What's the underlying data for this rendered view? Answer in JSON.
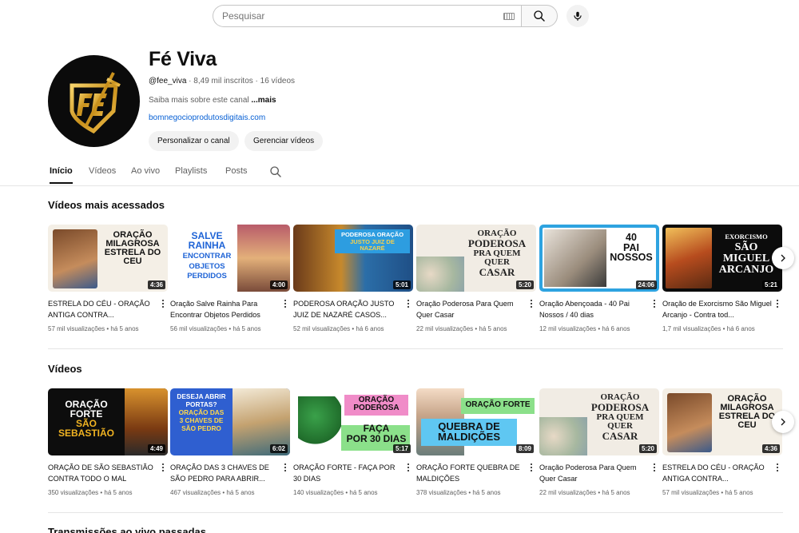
{
  "search": {
    "placeholder": "Pesquisar"
  },
  "channel": {
    "name": "Fé Viva",
    "handle": "@fee_viva",
    "subscribers": "8,49 mil inscritos",
    "videos_count": "16 vídeos",
    "separator": " · ",
    "description": "Saiba mais sobre este canal",
    "more": "...mais",
    "link": "bomnegocioprodutosdigitais.com",
    "customize_label": "Personalizar o canal",
    "manage_label": "Gerenciar vídeos"
  },
  "tabs": [
    {
      "label": "Início",
      "active": true
    },
    {
      "label": "Vídeos"
    },
    {
      "label": "Ao vivo"
    },
    {
      "label": "Playlists"
    },
    {
      "label": "Posts"
    }
  ],
  "sections": [
    {
      "title": "Vídeos mais acessados",
      "videos": [
        {
          "title": "ESTRELA DO CÉU - ORAÇÃO ANTIGA CONTRA...",
          "views": "57 mil visualizações",
          "age": "há 5 anos",
          "duration": "4:36",
          "thumb_text": [
            "ORAÇÃO",
            "MILAGROSA",
            "ESTRELA DO",
            "CEU"
          ]
        },
        {
          "title": "Oração Salve Rainha Para Encontrar Objetos Perdidos",
          "views": "56 mil visualizações",
          "age": "há 5 anos",
          "duration": "4:00",
          "thumb_text": [
            "SALVE",
            "RAINHA",
            "ENCONTRAR",
            "OBJETOS",
            "PERDIDOS"
          ]
        },
        {
          "title": "PODEROSA ORAÇÃO JUSTO JUIZ DE NAZARÉ CASOS...",
          "views": "52 mil visualizações",
          "age": "há 6 anos",
          "duration": "5:01",
          "thumb_text": [
            "PODEROSA ORAÇÃO",
            "JUSTO JUIZ DE",
            "NAZARÉ"
          ]
        },
        {
          "title": "Oração Poderosa Para Quem Quer Casar",
          "views": "22 mil visualizações",
          "age": "há 5 anos",
          "duration": "5:20",
          "thumb_text": [
            "ORAÇÃO",
            "PODEROSA",
            "PRA QUEM",
            "QUER",
            "CASAR"
          ]
        },
        {
          "title": "Oração Abençoada - 40 Pai Nossos / 40 dias",
          "views": "12 mil visualizações",
          "age": "há 6 anos",
          "duration": "24:06",
          "thumb_text": [
            "40",
            "PAI",
            "NOSSOS"
          ]
        },
        {
          "title": "Oração de Exorcismo São Miguel Arcanjo - Contra tod...",
          "views": "1,7 mil visualizações",
          "age": "há 6 anos",
          "duration": "5:21",
          "thumb_text": [
            "EXORCISMO",
            "SÃO",
            "MIGUEL",
            "ARCANJO"
          ]
        }
      ]
    },
    {
      "title": "Vídeos",
      "videos": [
        {
          "title": "ORAÇÃO DE SÃO SEBASTIÃO CONTRA TODO O MAL",
          "views": "350 visualizações",
          "age": "há 5 anos",
          "duration": "4:49",
          "thumb_text": [
            "ORAÇÃO",
            "FORTE",
            "SÃO",
            "SEBASTIÃO"
          ]
        },
        {
          "title": "ORAÇÃO DAS 3 CHAVES DE SÃO PEDRO PARA ABRIR...",
          "views": "467 visualizações",
          "age": "há 5 anos",
          "duration": "6:02",
          "thumb_text": [
            "DESEJA ABRIR",
            "PORTAS?",
            "ORAÇÃO DAS",
            "3 CHAVES DE",
            "SÃO PEDRO"
          ]
        },
        {
          "title": "ORAÇÃO FORTE - FAÇA POR 30 DIAS",
          "views": "140 visualizações",
          "age": "há 5 anos",
          "duration": "5:17",
          "thumb_text": [
            "ORAÇÃO",
            "PODEROSA",
            "FAÇA",
            "POR 30 DIAS"
          ]
        },
        {
          "title": "ORAÇÃO FORTE QUEBRA DE MALDIÇÕES",
          "views": "378 visualizações",
          "age": "há 5 anos",
          "duration": "8:09",
          "thumb_text": [
            "ORAÇÃO FORTE",
            "QUEBRA DE",
            "MALDIÇÕES"
          ]
        },
        {
          "title": "Oração Poderosa Para Quem Quer Casar",
          "views": "22 mil visualizações",
          "age": "há 5 anos",
          "duration": "5:20",
          "thumb_text": [
            "ORAÇÃO",
            "PODEROSA",
            "PRA QUEM",
            "QUER",
            "CASAR"
          ]
        },
        {
          "title": "ESTRELA DO CÉU - ORAÇÃO ANTIGA CONTRA...",
          "views": "57 mil visualizações",
          "age": "há 5 anos",
          "duration": "4:36",
          "thumb_text": [
            "ORAÇÃO",
            "MILAGROSA",
            "ESTRELA DO",
            "CEU"
          ]
        }
      ]
    }
  ],
  "next_section_title": "Transmissões ao vivo passadas",
  "colors": {
    "link": "#065fd4",
    "text": "#0f0f0f",
    "muted": "#606060",
    "pill": "#f2f2f2",
    "gold": "#d9a520"
  },
  "icons": {
    "search": "search-icon",
    "mic": "microphone-icon",
    "keyboard": "keyboard-icon",
    "next": "chevron-right-icon",
    "more": "more-vert-icon"
  }
}
